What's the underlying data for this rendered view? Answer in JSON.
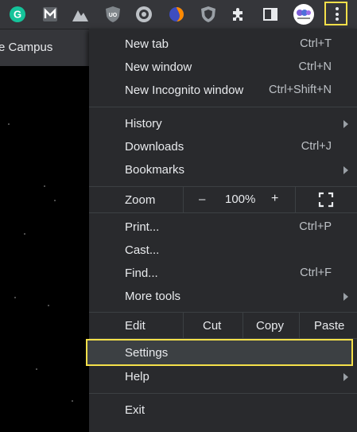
{
  "browser": {
    "tab_title": "e Campus",
    "extensions": [
      "grammarly-icon",
      "m-extension-icon",
      "mountain-extension-icon",
      "ublock-icon",
      "record-icon",
      "firefox-like-icon",
      "shield-icon",
      "puzzle-icon",
      "side-panel-icon",
      "profile-avatar"
    ]
  },
  "menu": {
    "new_tab": {
      "label": "New tab",
      "shortcut": "Ctrl+T"
    },
    "new_window": {
      "label": "New window",
      "shortcut": "Ctrl+N"
    },
    "new_incognito": {
      "label": "New Incognito window",
      "shortcut": "Ctrl+Shift+N"
    },
    "history": {
      "label": "History"
    },
    "downloads": {
      "label": "Downloads",
      "shortcut": "Ctrl+J"
    },
    "bookmarks": {
      "label": "Bookmarks"
    },
    "zoom": {
      "label": "Zoom",
      "minus": "–",
      "value": "100%",
      "plus": "+"
    },
    "print": {
      "label": "Print...",
      "shortcut": "Ctrl+P"
    },
    "cast": {
      "label": "Cast..."
    },
    "find": {
      "label": "Find...",
      "shortcut": "Ctrl+F"
    },
    "more_tools": {
      "label": "More tools"
    },
    "edit": {
      "label": "Edit",
      "cut": "Cut",
      "copy": "Copy",
      "paste": "Paste"
    },
    "settings": {
      "label": "Settings"
    },
    "help": {
      "label": "Help"
    },
    "exit": {
      "label": "Exit"
    }
  },
  "colors": {
    "highlight": "#f5e04a",
    "menu_bg": "#292a2d",
    "toolbar_bg": "#35363a"
  }
}
